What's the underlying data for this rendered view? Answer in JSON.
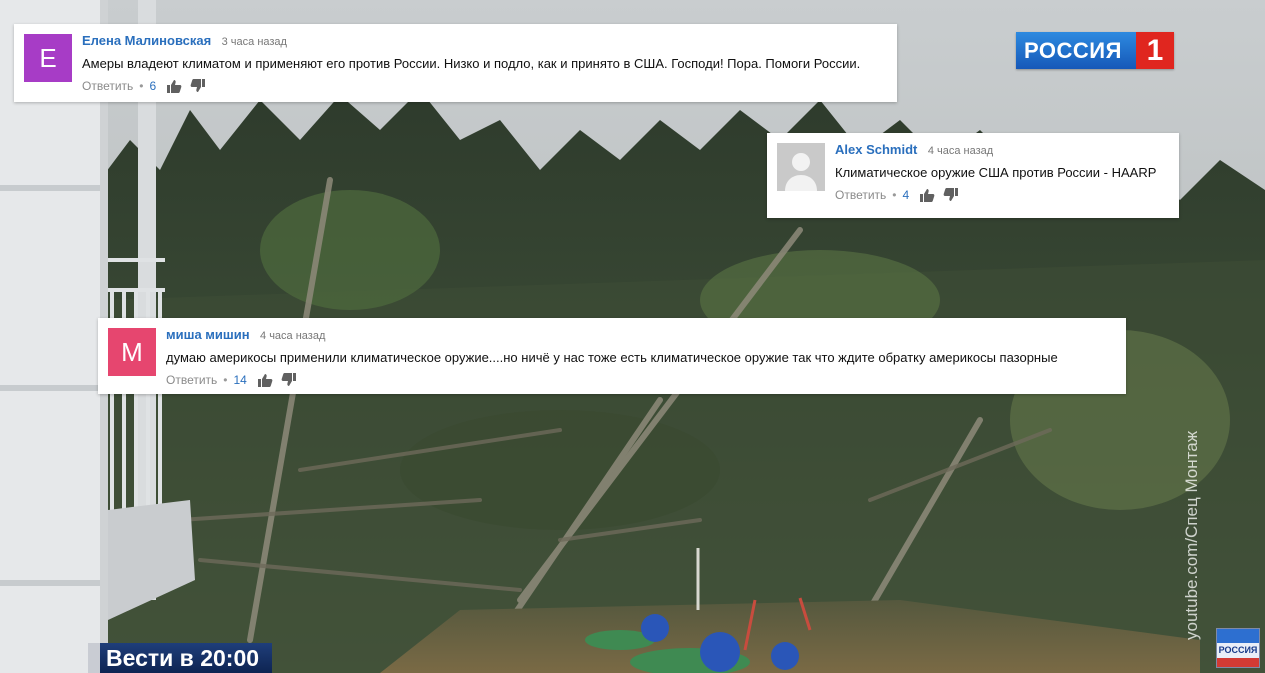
{
  "comments": [
    {
      "avatar_letter": "E",
      "avatar_color": "#a73cc6",
      "author": "Елена Малиновская",
      "time": "3 часа назад",
      "text": "Амеры владеют климатом и применяют его против России.  Низко и подло, как и принято в США. Господи! Пора. Помоги России.",
      "reply_label": "Ответить",
      "likes": "6"
    },
    {
      "avatar_letter": "",
      "avatar_color": "#c9c9c9",
      "author": "Alex Schmidt",
      "time": "4 часа назад",
      "text": "Климатическое оружие США против России  -  HAARP",
      "reply_label": "Ответить",
      "likes": "4"
    },
    {
      "avatar_letter": "M",
      "avatar_color": "#e6466f",
      "author": "миша мишин",
      "time": "4 часа назад",
      "text": "думаю  америкосы применили климатическое оружие....но ничё  у нас тоже есть климатическое  оружие так что ждите обратку америкосы  пазорные",
      "reply_label": "Ответить",
      "likes": "14"
    }
  ],
  "channel_logo": {
    "text": "РОССИЯ",
    "number": "1",
    "color_blue": "#1e6fcc",
    "color_red": "#e0261f"
  },
  "news_banner": "Вести в 20:00",
  "watermark": "youtube.com/Спец Монтаж",
  "corner_logo_text": "РОССИЯ"
}
